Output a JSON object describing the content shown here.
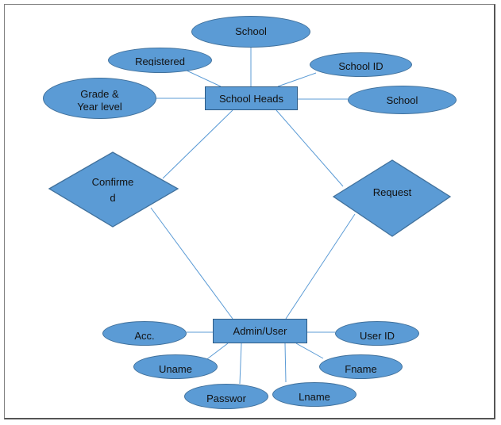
{
  "colors": {
    "fill": "#5b9bd5",
    "stroke": "#41719c",
    "line": "#5b9bd5"
  },
  "entities": {
    "school_heads": "School Heads",
    "admin_user": "Admin/User"
  },
  "relationships": {
    "confirmed": [
      "Confirme",
      "d"
    ],
    "request": "Request"
  },
  "attributes": {
    "school_heads": {
      "school_top": "School",
      "registered": "Registered",
      "school_id": "School ID",
      "grade_year": "Grade & Year level",
      "school_right": "School"
    },
    "admin_user": {
      "acc": "Acc.",
      "user_id": "User ID",
      "uname": "Uname",
      "fname": "Fname",
      "password": "Passwor",
      "lname": "Lname"
    }
  }
}
